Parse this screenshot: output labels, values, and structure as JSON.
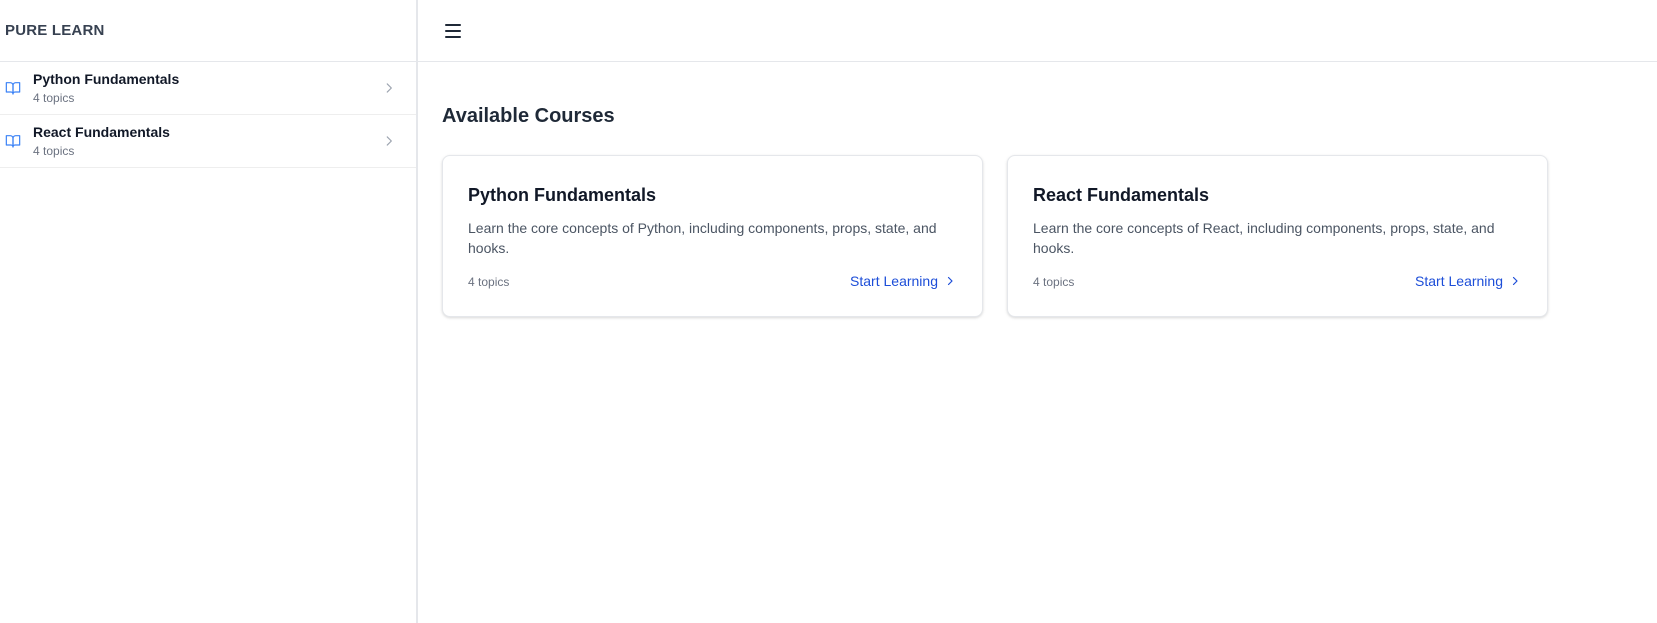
{
  "brand": "PURE LEARN",
  "sidebar": {
    "items": [
      {
        "title": "Python Fundamentals",
        "subtitle": "4 topics"
      },
      {
        "title": "React Fundamentals",
        "subtitle": "4 topics"
      }
    ]
  },
  "main": {
    "heading": "Available Courses",
    "courses": [
      {
        "title": "Python Fundamentals",
        "description": "Learn the core concepts of Python, including components, props, state, and hooks.",
        "topics": "4 topics",
        "cta": "Start Learning"
      },
      {
        "title": "React Fundamentals",
        "description": "Learn the core concepts of React, including components, props, state, and hooks.",
        "topics": "4 topics",
        "cta": "Start Learning"
      }
    ]
  },
  "icons": {
    "menu": "hamburger-menu-icon",
    "course": "book-open-icon",
    "arrow": "chevron-right-icon"
  },
  "colors": {
    "accent": "#1d4ed8",
    "book_icon": "#3b82f6",
    "chevron": "#9ca3af"
  }
}
